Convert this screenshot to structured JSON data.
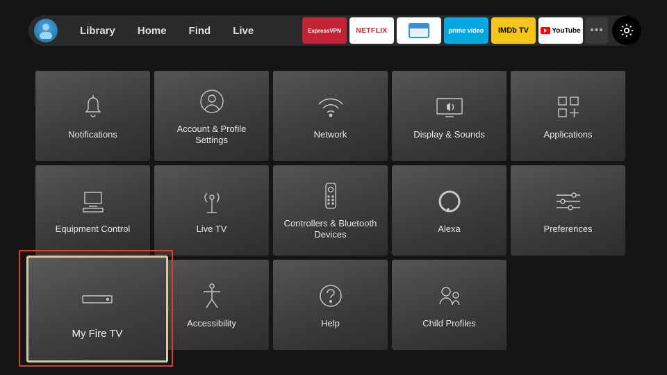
{
  "nav": {
    "library": "Library",
    "home": "Home",
    "find": "Find",
    "live": "Live"
  },
  "apps": {
    "express": "ExpressVPN",
    "netflix": "NETFLIX",
    "prime": "prime video",
    "imdb": "IMDb TV",
    "youtube": "YouTube"
  },
  "tiles": {
    "notifications": "Notifications",
    "account": "Account & Profile Settings",
    "network": "Network",
    "display": "Display & Sounds",
    "applications": "Applications",
    "equipment": "Equipment Control",
    "livetv": "Live TV",
    "controllers": "Controllers & Bluetooth Devices",
    "alexa": "Alexa",
    "preferences": "Preferences",
    "myfiretv": "My Fire TV",
    "accessibility": "Accessibility",
    "help": "Help",
    "childprofiles": "Child Profiles"
  }
}
